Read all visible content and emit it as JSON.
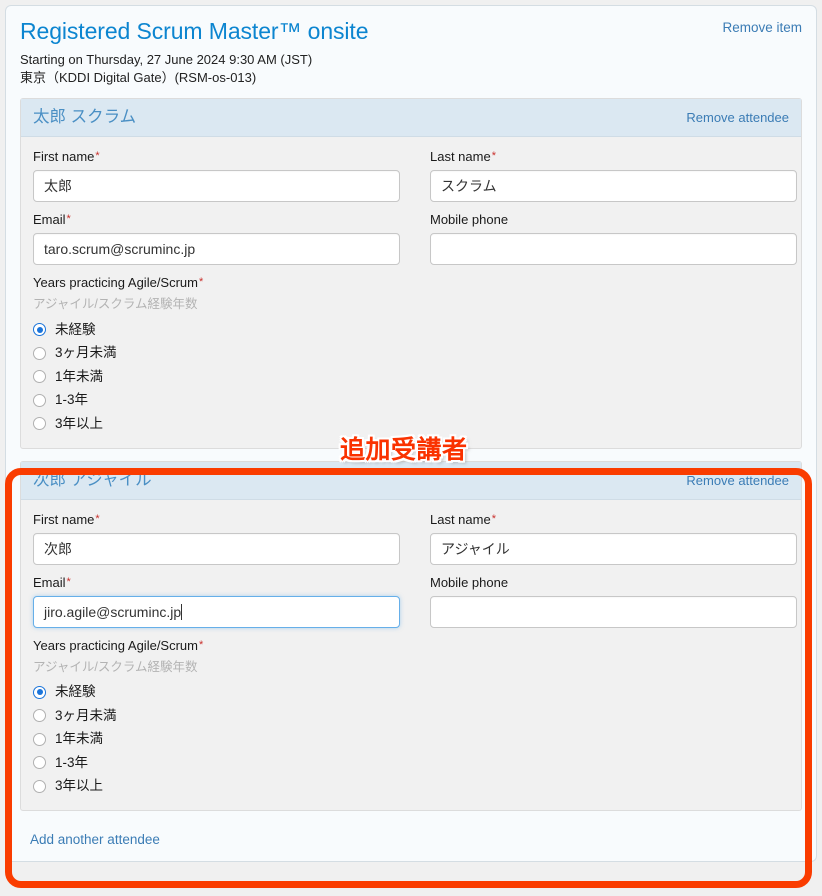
{
  "colors": {
    "title_blue": "#0c85d0",
    "link_blue": "#3b7cb5",
    "attendee_header_bg": "#dbe8f2",
    "attendee_name_blue": "#4a8fc4",
    "required_red": "#c9302c",
    "annotation_red": "#fa3200",
    "focus_border": "#66afe9",
    "page_bg": "#f0f0f0"
  },
  "item": {
    "title": "Registered Scrum Master™ onsite",
    "remove_item_label": "Remove item",
    "starting_line": "Starting on Thursday, 27 June 2024 9:30 AM (JST)",
    "venue_line": "東京（KDDI Digital Gate）(RSM-os-013)"
  },
  "labels": {
    "first_name": "First name",
    "last_name": "Last name",
    "email": "Email",
    "mobile_phone": "Mobile phone",
    "years_practicing": "Years practicing Agile/Scrum",
    "years_sublabel": "アジャイル/スクラム経験年数",
    "required_mark": "*",
    "remove_attendee_label": "Remove attendee"
  },
  "radio_options": [
    "未経験",
    "3ヶ月未満",
    "1年未満",
    "1-3年",
    "3年以上"
  ],
  "attendees": [
    {
      "header_name": "太郎 スクラム",
      "first_name": "太郎",
      "last_name": "スクラム",
      "email": "taro.scrum@scruminc.jp",
      "mobile_phone": "",
      "selected_years": "未経験",
      "email_focused": false
    },
    {
      "header_name": "次郎 アジャイル",
      "first_name": "次郎",
      "last_name": "アジャイル",
      "email": "jiro.agile@scruminc.jp",
      "mobile_phone": "",
      "selected_years": "未経験",
      "email_focused": true
    }
  ],
  "footer": {
    "add_another_attendee": "Add another attendee"
  },
  "annotation": {
    "text": "追加受講者"
  }
}
